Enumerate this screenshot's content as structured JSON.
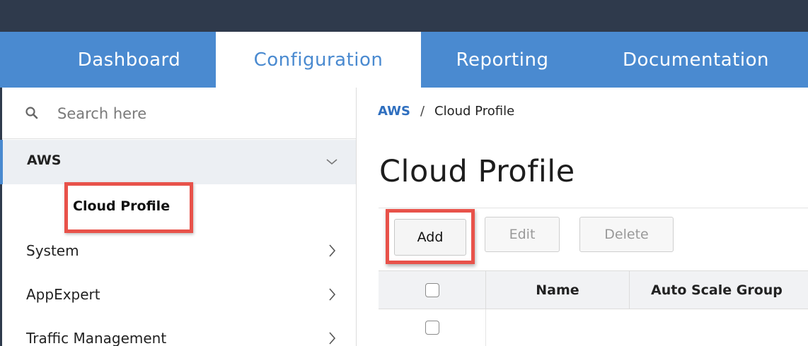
{
  "nav": {
    "tabs": [
      {
        "label": "Dashboard",
        "active": false
      },
      {
        "label": "Configuration",
        "active": true
      },
      {
        "label": "Reporting",
        "active": false
      },
      {
        "label": "Documentation",
        "active": false
      }
    ]
  },
  "sidebar": {
    "search_placeholder": "Search here",
    "items": [
      {
        "label": "AWS",
        "expanded": true,
        "icon": "chevron-down-icon"
      },
      {
        "label": "Cloud Profile",
        "selected": true
      },
      {
        "label": "System",
        "icon": "chevron-right-icon"
      },
      {
        "label": "AppExpert",
        "icon": "chevron-right-icon"
      },
      {
        "label": "Traffic Management",
        "icon": "chevron-right-icon"
      }
    ]
  },
  "breadcrumb": {
    "parent": "AWS",
    "separator": "/",
    "current": "Cloud Profile"
  },
  "main": {
    "title": "Cloud Profile",
    "toolbar": {
      "add_label": "Add",
      "edit_label": "Edit",
      "delete_label": "Delete"
    },
    "table": {
      "columns": [
        "Name",
        "Auto Scale Group"
      ],
      "rows": [
        {
          "checked": false
        }
      ]
    }
  },
  "colors": {
    "topbar": "#2f3a4c",
    "nav_bar": "#4a8ad0",
    "highlight_box": "#e8524a",
    "link": "#2f6fbf"
  }
}
